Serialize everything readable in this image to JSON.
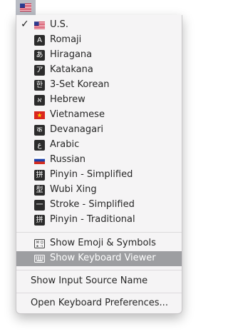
{
  "menubar": {
    "current_flag": "us-flag"
  },
  "menu": {
    "input_sources": [
      {
        "label": "U.S.",
        "icon": "us-flag",
        "checked": true
      },
      {
        "label": "Romaji",
        "icon": "A-glyph",
        "glyph": "A"
      },
      {
        "label": "Hiragana",
        "icon": "hiragana-glyph",
        "glyph": "あ"
      },
      {
        "label": "Katakana",
        "icon": "katakana-glyph",
        "glyph": "ア"
      },
      {
        "label": "3-Set Korean",
        "icon": "korean-glyph",
        "glyph": "한"
      },
      {
        "label": "Hebrew",
        "icon": "hebrew-glyph",
        "glyph": "א"
      },
      {
        "label": "Vietnamese",
        "icon": "vietnam-flag"
      },
      {
        "label": "Devanagari",
        "icon": "devanagari-glyph",
        "glyph": "क"
      },
      {
        "label": "Arabic",
        "icon": "arabic-glyph",
        "glyph": "ع"
      },
      {
        "label": "Russian",
        "icon": "russia-flag"
      },
      {
        "label": "Pinyin - Simplified",
        "icon": "pinyin-glyph",
        "glyph": "拼"
      },
      {
        "label": "Wubi Xing",
        "icon": "wubi-glyph",
        "glyph": "型"
      },
      {
        "label": "Stroke - Simplified",
        "icon": "stroke-glyph",
        "glyph": "一"
      },
      {
        "label": "Pinyin - Traditional",
        "icon": "pinyin-trad-glyph",
        "glyph": "拼"
      }
    ],
    "show_emoji_symbols": "Show Emoji & Symbols",
    "show_keyboard_viewer": "Show Keyboard Viewer",
    "show_input_source_name": "Show Input Source Name",
    "open_keyboard_preferences": "Open Keyboard Preferences...",
    "check_mark": "✓"
  },
  "colors": {
    "highlight": "#9d9ea1",
    "menu_bg": "#f5f4f5",
    "text": "#262626"
  }
}
